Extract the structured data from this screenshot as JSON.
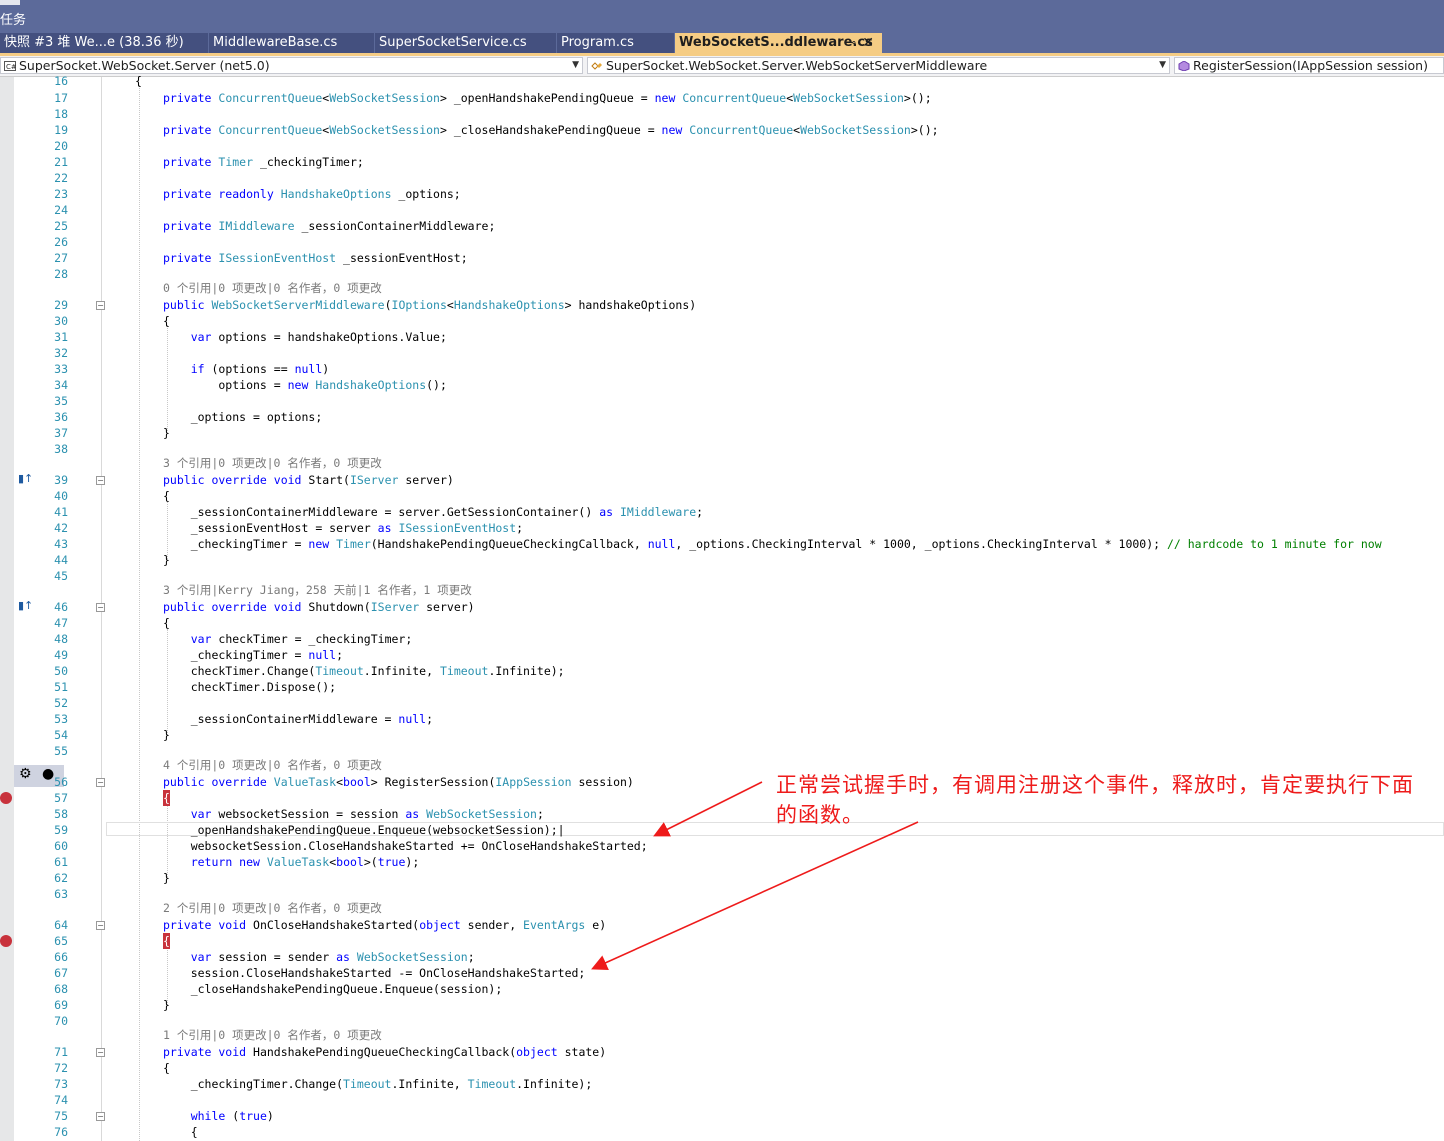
{
  "window": {
    "title": "任务"
  },
  "tabs": [
    {
      "label": "快照 #3 堆 We...e (38.36 秒)",
      "active": false
    },
    {
      "label": "MiddlewareBase.cs",
      "active": false
    },
    {
      "label": "SuperSocketService.cs",
      "active": false
    },
    {
      "label": "Program.cs",
      "active": false
    },
    {
      "label": "WebSocketS...ddleware.cs",
      "active": true
    }
  ],
  "active_tab_pin": "⊸",
  "active_tab_close": "✕",
  "navbar": {
    "project": "SuperSocket.WebSocket.Server (net5.0)",
    "class": "SuperSocket.WebSocket.Server.WebSocketServerMiddleware",
    "member": "RegisterSession(IAppSession session)"
  },
  "lens": {
    "l29": "0 个引用|0 项更改|0 名作者，0 项更改",
    "l39": "3 个引用|0 项更改|0 名作者，0 项更改",
    "l46": "3 个引用|Kerry Jiang，258 天前|1 名作者，1 项更改",
    "l56": "4 个引用|0 项更改|0 名作者，0 项更改",
    "l64": "2 个引用|0 项更改|0 名作者，0 项更改",
    "l71": "1 个引用|0 项更改|0 名作者，0 项更改"
  },
  "annotation": "正常尝试握手时，有调用注册这个事件，释放时，肯定要执行下面的函数。",
  "colors": {
    "keyword": "#0000ff",
    "type": "#2b91af",
    "comment": "#008000",
    "linenumber": "#2b91af",
    "annotation": "#ee1b1b",
    "activeTab": "#f5cc84"
  },
  "icons": {
    "breakpoint": "breakpoint-icon",
    "override": "override-glyph-icon",
    "gear": "gear-icon"
  }
}
